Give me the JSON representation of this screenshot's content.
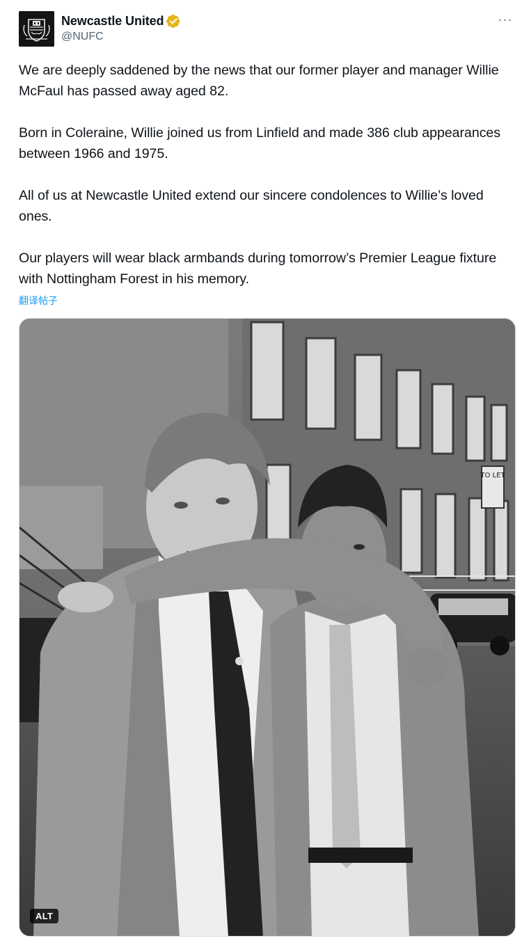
{
  "author": {
    "display_name": "Newcastle United",
    "handle": "@NUFC",
    "verified_color": "#e2b719",
    "avatar_icon": "club-crest-icon"
  },
  "menu": {
    "more_label": "···"
  },
  "tweet": {
    "paragraphs": [
      "We are deeply saddened by the news that our former player and manager Willie McFaul has passed away aged 82.",
      "Born in Coleraine, Willie joined us from Linfield and made 386 club appearances between 1966 and 1975.",
      "All of us at Newcastle United extend our sincere condolences to Willie’s loved ones.",
      "Our players will wear black armbands during tomorrow’s Premier League fixture with Nottingham Forest in his memory."
    ],
    "translate_label": "翻译帖子"
  },
  "media": {
    "alt_label": "ALT",
    "sign_text": "TO LET"
  },
  "colors": {
    "link": "#1d9bf0",
    "secondary_text": "#536471",
    "primary_text": "#0f1419"
  }
}
